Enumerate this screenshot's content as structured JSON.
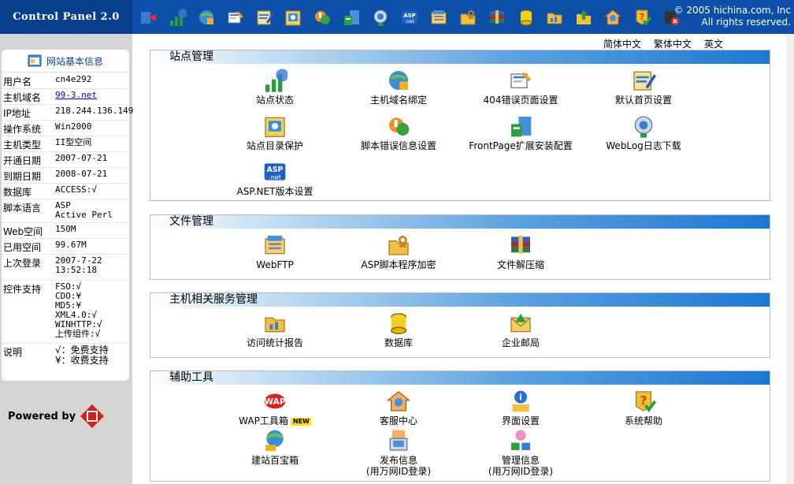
{
  "app": {
    "title": "Control Panel 2.0"
  },
  "copyright": {
    "line1": "© 2005 hichina.com, Inc",
    "line2": "All rights reserved."
  },
  "toolbar": [
    {
      "icon": "exit-icon"
    },
    {
      "icon": "site-status-icon"
    },
    {
      "icon": "domain-bind-icon"
    },
    {
      "icon": "error-page-icon"
    },
    {
      "icon": "home-page-icon"
    },
    {
      "icon": "dir-protect-icon"
    },
    {
      "icon": "script-error-icon"
    },
    {
      "icon": "frontpage-icon"
    },
    {
      "icon": "weblog-icon"
    },
    {
      "icon": "aspnet-icon"
    },
    {
      "icon": "webftp-icon"
    },
    {
      "icon": "asp-encrypt-icon"
    },
    {
      "icon": "unzip-icon"
    },
    {
      "icon": "database-icon"
    },
    {
      "icon": "stats-icon"
    },
    {
      "icon": "upload-icon"
    },
    {
      "icon": "customer-service-icon"
    },
    {
      "icon": "help-icon"
    },
    {
      "icon": "logout-icon"
    }
  ],
  "sidebar": {
    "header": "网站基本信息",
    "rows": [
      {
        "k": "用户名",
        "v": "cn4e292"
      },
      {
        "k": "主机域名",
        "v": "99-3.net",
        "link": true
      },
      {
        "k": "IP地址",
        "v": "218.244.136.149"
      },
      {
        "k": "操作系统",
        "v": "Win2000"
      },
      {
        "k": "主机类型",
        "v": "II型空间"
      },
      {
        "k": "开通日期",
        "v": "2007-07-21"
      },
      {
        "k": "到期日期",
        "v": "2008-07-21"
      },
      {
        "k": "数据库",
        "v": "ACCESS:√"
      },
      {
        "k": "脚本语言",
        "v": "ASP\nActive Perl"
      },
      {
        "k": "Web空间",
        "v": "150M"
      },
      {
        "k": "已用空间",
        "v": "99.67M"
      },
      {
        "k": "上次登录",
        "v": "2007-7-22\n13:52:18"
      },
      {
        "k": "控件支持",
        "v": "FSO:√\nCDO:¥\nMD5:¥\nXML4.0:√\nWINHTTP:√\n上传组件:√"
      },
      {
        "k": "说明",
        "v": "√：免费支持\n¥：收费支持"
      }
    ],
    "powered_by": "Powered by"
  },
  "lang": [
    "简体中文",
    "繁体中文",
    "英文"
  ],
  "sections": [
    {
      "title": "站点管理",
      "items": [
        {
          "label": "站点状态",
          "icon": "site-status-icon"
        },
        {
          "label": "主机域名绑定",
          "icon": "domain-bind-icon"
        },
        {
          "label": "404错误页面设置",
          "icon": "error-page-icon"
        },
        {
          "label": "默认首页设置",
          "icon": "home-page-icon"
        },
        {
          "label": "站点目录保护",
          "icon": "dir-protect-icon"
        },
        {
          "label": "脚本错误信息设置",
          "icon": "script-error-icon"
        },
        {
          "label": "FrontPage扩展安装配置",
          "icon": "frontpage-icon"
        },
        {
          "label": "WebLog日志下载",
          "icon": "weblog-icon"
        },
        {
          "label": "ASP.NET版本设置",
          "icon": "aspnet-icon"
        }
      ]
    },
    {
      "title": "文件管理",
      "items": [
        {
          "label": "WebFTP",
          "icon": "webftp-icon"
        },
        {
          "label": "ASP脚本程序加密",
          "icon": "asp-encrypt-icon"
        },
        {
          "label": "文件解压缩",
          "icon": "unzip-icon"
        }
      ]
    },
    {
      "title": "主机相关服务管理",
      "items": [
        {
          "label": "访问统计报告",
          "icon": "stats-icon"
        },
        {
          "label": "数据库",
          "icon": "database-icon"
        },
        {
          "label": "企业邮局",
          "icon": "mail-icon"
        }
      ]
    },
    {
      "title": "辅助工具",
      "items": [
        {
          "label": "WAP工具箱",
          "icon": "wap-icon",
          "badge": "NEW"
        },
        {
          "label": "客服中心",
          "icon": "customer-service-icon"
        },
        {
          "label": "界面设置",
          "icon": "interface-icon"
        },
        {
          "label": "系统帮助",
          "icon": "help-icon"
        },
        {
          "label": "建站百宝箱",
          "icon": "toolbox-icon"
        },
        {
          "label": "发布信息\n(用万网ID登录)",
          "icon": "publish-icon"
        },
        {
          "label": "管理信息\n(用万网ID登录)",
          "icon": "manage-icon"
        }
      ]
    }
  ]
}
